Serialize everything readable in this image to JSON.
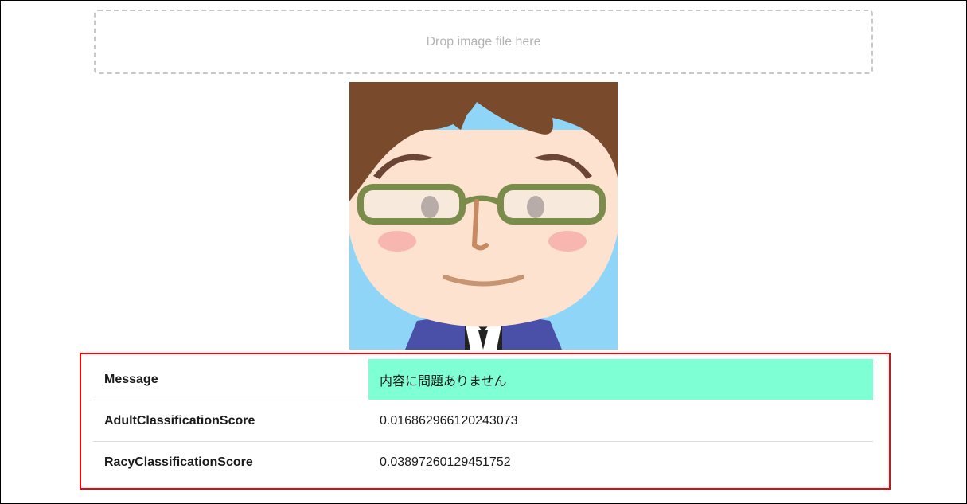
{
  "dropzone": {
    "label": "Drop image file here"
  },
  "preview": {
    "kind": "cartoon-avatar"
  },
  "results": {
    "rows": [
      {
        "label": "Message",
        "value": "内容に問題ありません",
        "status_color": "#7fffd4"
      },
      {
        "label": "AdultClassificationScore",
        "value": "0.016862966120243073"
      },
      {
        "label": "RacyClassificationScore",
        "value": "0.03897260129451752"
      }
    ]
  },
  "colors": {
    "highlight_border": "#ff0000",
    "dropzone_border": "#c8c8c8",
    "message_ok_background": "#7fffd4"
  }
}
